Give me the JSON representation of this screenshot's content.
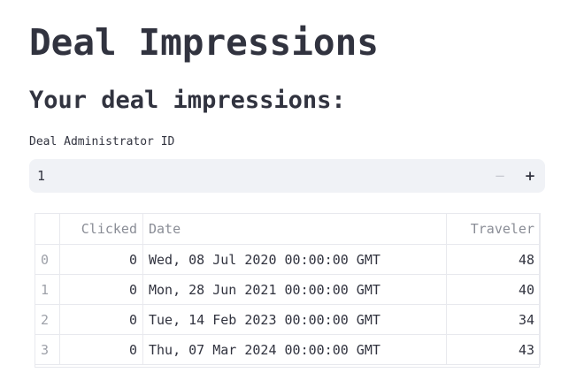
{
  "page": {
    "title": "Deal Impressions",
    "section_title": "Your deal impressions:"
  },
  "admin_input": {
    "label": "Deal Administrator ID",
    "value": "1",
    "decrement_label": "−",
    "increment_label": "+"
  },
  "table": {
    "columns": [
      "",
      "Clicked",
      "Date",
      "Traveler"
    ],
    "rows": [
      {
        "index": "0",
        "clicked": "0",
        "date": "Wed, 08 Jul 2020 00:00:00 GMT",
        "traveler": "48"
      },
      {
        "index": "1",
        "clicked": "0",
        "date": "Mon, 28 Jun 2021 00:00:00 GMT",
        "traveler": "40"
      },
      {
        "index": "2",
        "clicked": "0",
        "date": "Tue, 14 Feb 2023 00:00:00 GMT",
        "traveler": "34"
      },
      {
        "index": "3",
        "clicked": "0",
        "date": "Thu, 07 Mar 2024 00:00:00 GMT",
        "traveler": "43"
      }
    ]
  },
  "colors": {
    "text": "#31333f",
    "input_background": "#f0f2f6",
    "table_border": "#e8e9ee",
    "header_text": "#8a8d96"
  }
}
